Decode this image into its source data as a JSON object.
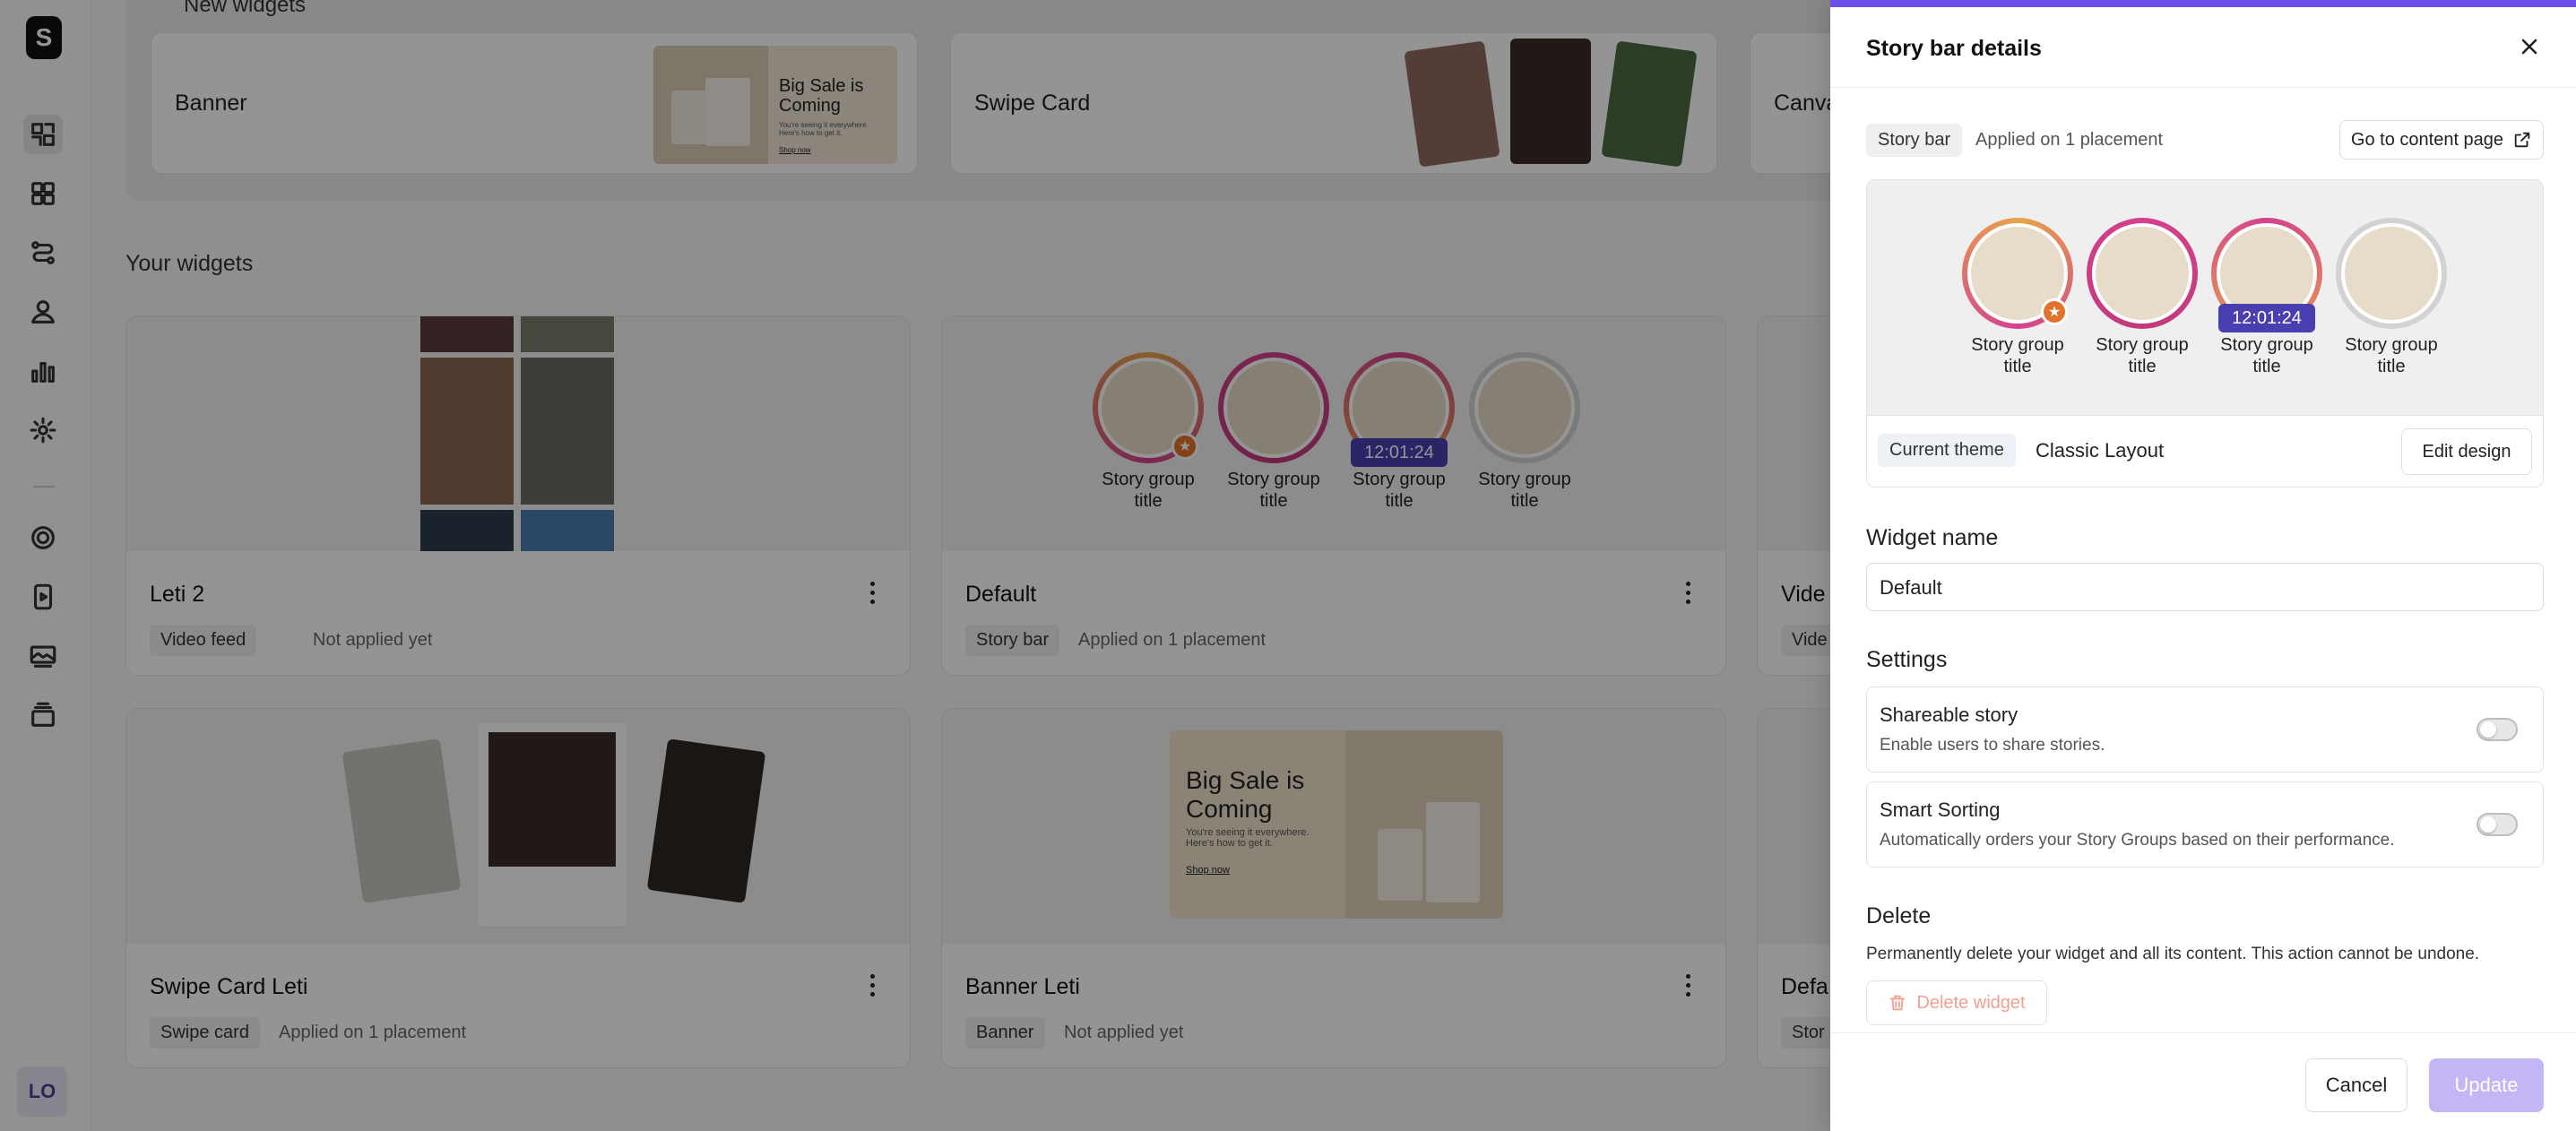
{
  "sidebar": {
    "logo": "S",
    "avatar": "LO"
  },
  "new_widgets": {
    "title": "New widgets",
    "cards": [
      {
        "label": "Banner",
        "preview_heading": "Big Sale is Coming",
        "preview_body": "You're seeing it everywhere. Here's how to get it.",
        "preview_link": "Shop now"
      },
      {
        "label": "Swipe Card"
      },
      {
        "label": "Canva"
      }
    ]
  },
  "your_widgets": {
    "title": "Your widgets",
    "cards": [
      {
        "name": "Leti 2",
        "type": "Video feed",
        "status": "Not applied yet"
      },
      {
        "name": "Default",
        "type": "Story bar",
        "status": "Applied on 1 placement"
      },
      {
        "name": "Vide",
        "type": "Vide",
        "status": ""
      },
      {
        "name": "Swipe Card Leti",
        "type": "Swipe card",
        "status": "Applied on 1 placement"
      },
      {
        "name": "Banner Leti",
        "type": "Banner",
        "status": "Not applied yet"
      },
      {
        "name": "Defa",
        "type": "Stor",
        "status": ""
      }
    ],
    "story_label": "Story group title",
    "timer": "12:01:24",
    "banner_heading": "Big Sale is Coming",
    "banner_body": "You're seeing it everywhere. Here's how to get it.",
    "banner_link": "Shop now"
  },
  "panel": {
    "title": "Story bar details",
    "type_chip": "Story bar",
    "applied": "Applied on 1 placement",
    "go_content": "Go to content page",
    "story_label": "Story group title",
    "timer": "12:01:24",
    "theme_chip": "Current theme",
    "theme_name": "Classic Layout",
    "edit_design": "Edit design",
    "widget_name_label": "Widget name",
    "widget_name_value": "Default",
    "settings_label": "Settings",
    "settings": [
      {
        "title": "Shareable story",
        "desc": "Enable users to share stories.",
        "on": false
      },
      {
        "title": "Smart Sorting",
        "desc": "Automatically orders your Story Groups based on their performance.",
        "on": false
      }
    ],
    "delete_label": "Delete",
    "delete_desc": "Permanently delete your widget and all its content. This action cannot be undone.",
    "delete_btn": "Delete widget",
    "cancel": "Cancel",
    "update": "Update"
  },
  "colors": {
    "accent": "#6c4ee6",
    "timer": "#4a3fb0",
    "badge": "#e3732c",
    "update_disabled": "#c4b5f4"
  }
}
